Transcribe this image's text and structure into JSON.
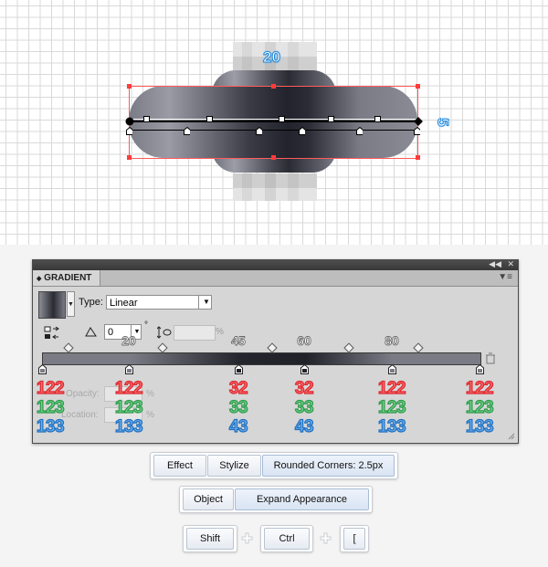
{
  "canvas": {
    "width_label": "20",
    "height_label": "5"
  },
  "panel": {
    "title": "GRADIENT",
    "type_label": "Type:",
    "type_value": "Linear",
    "angle_value": "0",
    "degree_symbol": "°",
    "aspect_percent": "%",
    "opacity_label": "Opacity:",
    "location_label": "Location:",
    "percent": "%",
    "position_labels": [
      "20",
      "45",
      "60",
      "80"
    ],
    "stops": [
      {
        "r": "122",
        "g": "123",
        "b": "133"
      },
      {
        "r": "122",
        "g": "123",
        "b": "133"
      },
      {
        "r": "32",
        "g": "33",
        "b": "43"
      },
      {
        "r": "32",
        "g": "33",
        "b": "43"
      },
      {
        "r": "122",
        "g": "123",
        "b": "133"
      },
      {
        "r": "122",
        "g": "123",
        "b": "133"
      }
    ],
    "stop_colors": [
      "#7a7b85",
      "#7a7b85",
      "#20212b",
      "#20212b",
      "#7a7b85",
      "#7a7b85"
    ]
  },
  "menus": {
    "effect": "Effect",
    "stylize": "Stylize",
    "rounded_corners": "Rounded Corners: 2.5px",
    "object": "Object",
    "expand_appearance": "Expand Appearance"
  },
  "keys": {
    "shift": "Shift",
    "ctrl": "Ctrl",
    "bracket": "["
  }
}
